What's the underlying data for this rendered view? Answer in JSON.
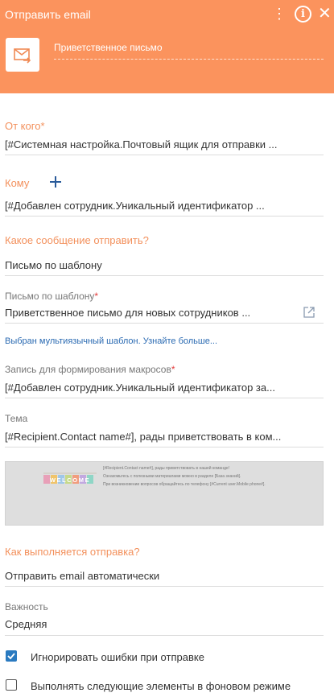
{
  "header": {
    "title": "Отправить email",
    "element_name": "Приветственное письмо",
    "menu_glyph": "⋮",
    "info_glyph": "i",
    "close_glyph": "✕",
    "element_icon": "email-send-icon",
    "bg_color": "#fb935d"
  },
  "fields": {
    "from": {
      "label": "От кого",
      "required": "*",
      "value": "[#Системная настройка.Почтовый ящик для отправки ..."
    },
    "to": {
      "label": "Кому",
      "value": "[#Добавлен сотрудник.Уникальный идентификатор  ..."
    },
    "what_message": {
      "label": "Какое сообщение отправить?",
      "value": "Письмо по шаблону"
    },
    "template": {
      "label": "Письмо по шаблону",
      "required": "*",
      "value": "Приветственное письмо для новых сотрудников ..."
    },
    "multilang_link": "Выбран мультиязычный шаблон. Узнайте больше...",
    "macro_record": {
      "label": "Запись для формирования макросов",
      "required": "*",
      "value": "[#Добавлен сотрудник.Уникальный идентификатор за..."
    },
    "subject": {
      "label": "Тема",
      "value": "[#Recipient.Contact name#], рады приветствовать в ком..."
    },
    "how_sent": {
      "label": "Как выполняется отправка?",
      "value": "Отправить email автоматически"
    },
    "importance": {
      "label": "Важность",
      "value": "Средняя"
    }
  },
  "preview": {
    "art_text": "WELCOME",
    "line1": "[#Recipient.Contact name#], рады приветствовать в нашей команде!",
    "line2": "Ознакомьтесь с полезными материалами можно в разделе [База знаний].",
    "line3": "При возникновении вопросов обращайтесь по телефону [#Current user.Mobile phone#]."
  },
  "checkboxes": {
    "ignore_errors": {
      "label": "Игнорировать ошибки при отправке",
      "checked": true
    },
    "background": {
      "label": "Выполнять следующие элементы в фоновом режиме",
      "checked": false
    }
  },
  "colors": {
    "accent": "#f3915d",
    "link": "#2a6ab2",
    "checkbox": "#2a7ac0",
    "required": "#e33b3b"
  }
}
